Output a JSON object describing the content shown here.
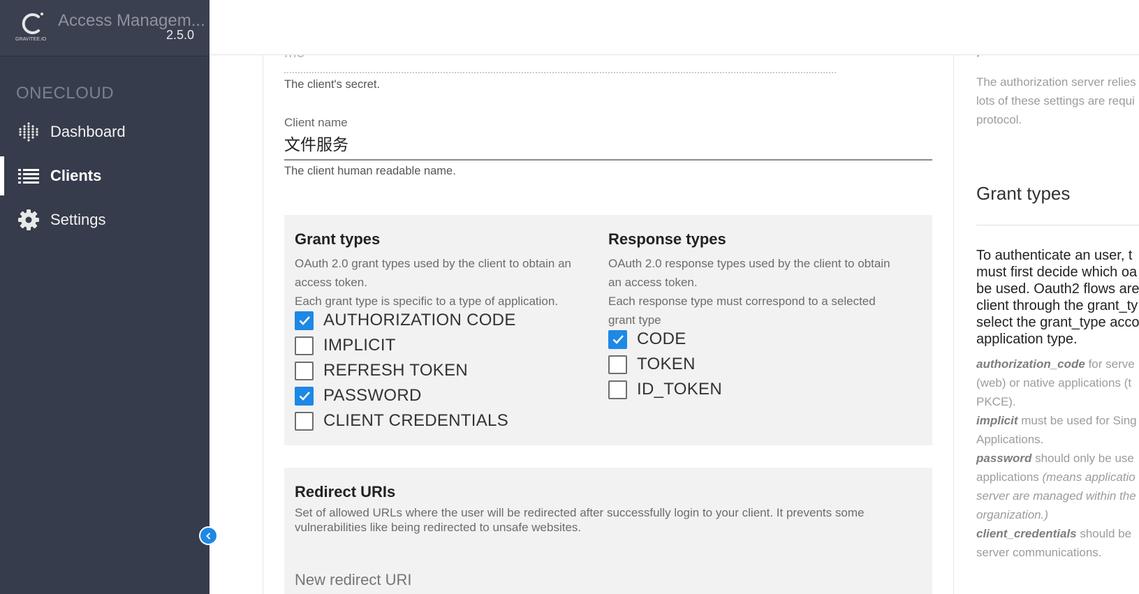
{
  "brand": {
    "title": "Access Managem...",
    "version": "2.5.0",
    "logo_text": "GRAVITEE.IO"
  },
  "sidebar": {
    "org": "ONECLOUD",
    "items": [
      {
        "label": "Dashboard",
        "icon": "dashboard-dots-icon"
      },
      {
        "label": "Clients",
        "icon": "list-icon"
      },
      {
        "label": "Settings",
        "icon": "gear-icon"
      }
    ],
    "collapse_icon": "chevron-left-icon"
  },
  "form": {
    "secret_partial": "me",
    "secret_hint": "The client's secret.",
    "client_name_label": "Client name",
    "client_name_value": "文件服务",
    "client_name_hint": "The client human readable name."
  },
  "grant_types": {
    "title": "Grant types",
    "desc_1": "OAuth 2.0 grant types used by the client to obtain an",
    "desc_2": "access token.",
    "desc_3": "Each grant type is specific to a type of application.",
    "options": [
      {
        "label": "AUTHORIZATION CODE",
        "checked": true
      },
      {
        "label": "IMPLICIT",
        "checked": false
      },
      {
        "label": "REFRESH TOKEN",
        "checked": false
      },
      {
        "label": "PASSWORD",
        "checked": true
      },
      {
        "label": "CLIENT CREDENTIALS",
        "checked": false
      }
    ]
  },
  "response_types": {
    "title": "Response types",
    "desc_1": "OAuth 2.0 response types used by the client to obtain",
    "desc_2": "an access token.",
    "desc_3": "Each response type must correspond to a selected",
    "desc_4": "grant type",
    "options": [
      {
        "label": "CODE",
        "checked": true
      },
      {
        "label": "TOKEN",
        "checked": false
      },
      {
        "label": "ID_TOKEN",
        "checked": false
      }
    ]
  },
  "redirect": {
    "title": "Redirect URIs",
    "desc": "Set of allowed URLs where the user will be redirected after successfully login to your client. It prevents some vulnerabilities like being redirected to unsafe websites.",
    "placeholder": "New redirect URI"
  },
  "help": {
    "top_mark": ",",
    "intro_1": "The authorization server relies",
    "intro_2": "lots of these settings are requi",
    "intro_3": "protocol.",
    "title": "Grant types",
    "body_1": "To authenticate an user, t",
    "body_2": "must first decide which oa",
    "body_3": "be used. Oauth2 flows are",
    "body_4": "client through the grant_ty",
    "body_5": "select the grant_type acco",
    "body_6": "application type.",
    "ac_term": "authorization_code",
    "ac_1": " for serve",
    "ac_2": "(web) or native applications (t",
    "ac_3": "PKCE).",
    "imp_term": "implicit",
    "imp_1": " must be used for Sing",
    "imp_2": "Applications.",
    "pw_term": "password",
    "pw_1": " should only be use",
    "pw_2": "applications ",
    "pw_2i": "(means applicatio",
    "pw_3": "server are managed within the",
    "pw_4": "organization.)",
    "cc_term": "client_credentials",
    "cc_1": " should be",
    "cc_2": "server communications."
  },
  "colors": {
    "sidebar_bg": "#363c4b",
    "accent": "#1e88e5",
    "panel_bg": "#f2f2f2"
  }
}
